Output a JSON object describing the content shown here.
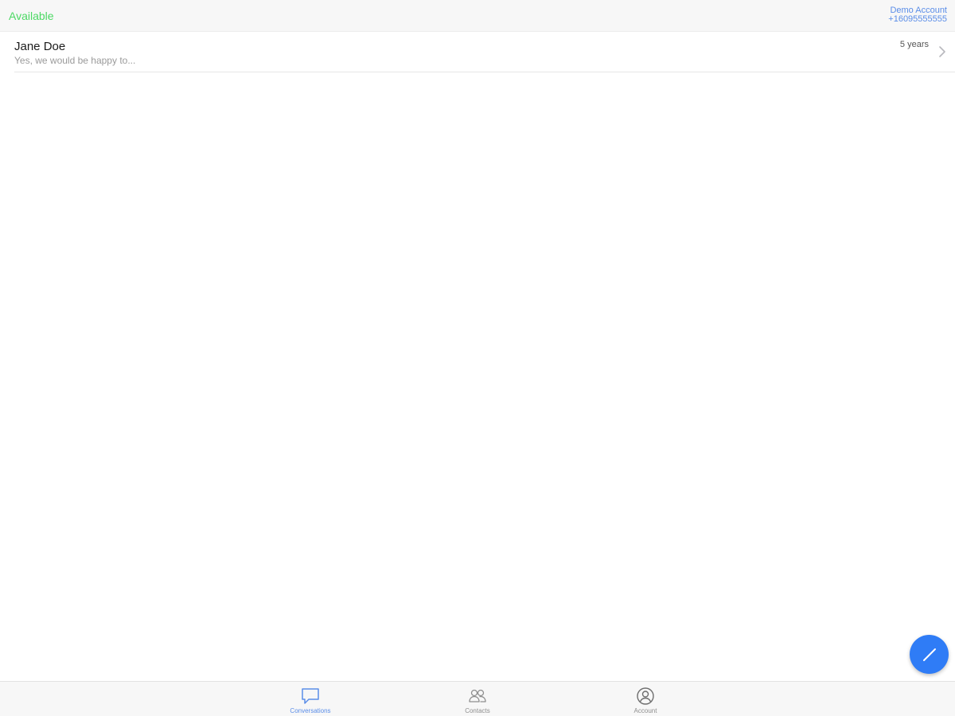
{
  "header": {
    "status": "Available",
    "account_name": "Demo Account",
    "account_number": "+16095555555"
  },
  "conversations": [
    {
      "name": "Jane Doe",
      "preview": "Yes, we would be happy to...",
      "time": "5 years"
    }
  ],
  "tabs": [
    {
      "label": "Conversations",
      "icon": "chat-bubble-icon",
      "active": true
    },
    {
      "label": "Contacts",
      "icon": "contacts-icon",
      "active": false
    },
    {
      "label": "Account",
      "icon": "account-circle-icon",
      "active": false
    }
  ],
  "fab": {
    "icon": "compose-pencil-icon"
  },
  "colors": {
    "status_available": "#4cd964",
    "accent": "#5a8de8",
    "fab": "#2f7cf6"
  }
}
